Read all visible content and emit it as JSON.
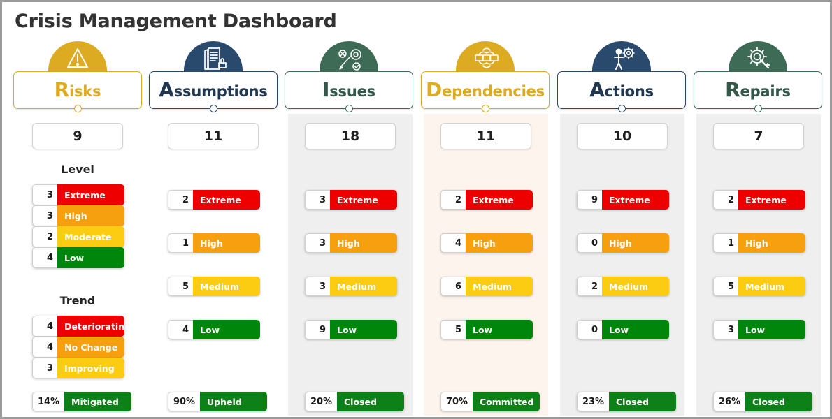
{
  "page": {
    "title": "Crisis Management Dashboard",
    "frame_border_color": "#9a9a9a",
    "background": "#ffffff"
  },
  "palette": {
    "extreme": "#ee0000",
    "high": "#f6a010",
    "moderate": "#fbcc12",
    "medium": "#fbcc12",
    "low": "#00860b",
    "deteriorating": "#ee0000",
    "no_change": "#f6a010",
    "improving": "#fbcc12",
    "footer_green": "#0e8018",
    "gold": "#ddab22",
    "navy": "#2a4a6d",
    "green": "#3d6b56",
    "panel_gray": "#efefef",
    "panel_cream": "#fdf5ed"
  },
  "columns": [
    {
      "key": "risks",
      "tab_label_cap": "R",
      "tab_label_rest": "isks",
      "icon": "warning-triangle-icon",
      "theme": "gold",
      "tab_border": "#ddab22",
      "tab_text_color": "#ddab22",
      "panel_bg": "none",
      "total": "9",
      "sections": [
        {
          "heading": "Level",
          "contiguous": true,
          "rows": [
            {
              "count": "3",
              "label": "Extreme",
              "color": "extreme"
            },
            {
              "count": "3",
              "label": "High",
              "color": "high"
            },
            {
              "count": "2",
              "label": "Moderate",
              "color": "moderate"
            },
            {
              "count": "4",
              "label": "Low",
              "color": "low"
            }
          ]
        },
        {
          "heading": "Trend",
          "contiguous": true,
          "rows": [
            {
              "count": "4",
              "label": "Deteriorating",
              "color": "deteriorating"
            },
            {
              "count": "4",
              "label": "No Change",
              "color": "no_change"
            },
            {
              "count": "3",
              "label": "Improving",
              "color": "improving"
            }
          ]
        }
      ],
      "footer": {
        "count": "14%",
        "label": "Mitigated",
        "color": "footer_green"
      }
    },
    {
      "key": "assumptions",
      "tab_label_cap": "A",
      "tab_label_rest": "ssumptions",
      "icon": "document-stamp-icon",
      "theme": "navy",
      "tab_border": "#2a4a6d",
      "tab_text_color": "#21364f",
      "panel_bg": "none",
      "total": "11",
      "sections": [
        {
          "heading": "",
          "contiguous": false,
          "rows": [
            {
              "count": "2",
              "label": "Extreme",
              "color": "extreme"
            },
            {
              "count": "1",
              "label": "High",
              "color": "high"
            },
            {
              "count": "5",
              "label": "Medium",
              "color": "medium"
            },
            {
              "count": "4",
              "label": "Low",
              "color": "low"
            }
          ]
        }
      ],
      "footer": {
        "count": "90%",
        "label": "Upheld",
        "color": "footer_green"
      }
    },
    {
      "key": "issues",
      "tab_label_cap": "I",
      "tab_label_rest": "ssues",
      "icon": "tools-gear-icon",
      "theme": "green",
      "tab_border": "#3d6b56",
      "tab_text_color": "#33584a",
      "panel_bg": "panel_gray",
      "total": "18",
      "sections": [
        {
          "heading": "",
          "contiguous": false,
          "rows": [
            {
              "count": "3",
              "label": "Extreme",
              "color": "extreme"
            },
            {
              "count": "3",
              "label": "High",
              "color": "high"
            },
            {
              "count": "3",
              "label": "Medium",
              "color": "medium"
            },
            {
              "count": "9",
              "label": "Low",
              "color": "low"
            }
          ]
        }
      ],
      "footer": {
        "count": "20%",
        "label": "Closed",
        "color": "footer_green"
      }
    },
    {
      "key": "dependencies",
      "tab_label_cap": "D",
      "tab_label_rest": "ependencies",
      "icon": "network-nodes-icon",
      "theme": "gold",
      "tab_border": "#ddab22",
      "tab_text_color": "#ddab22",
      "panel_bg": "panel_cream",
      "total": "11",
      "sections": [
        {
          "heading": "",
          "contiguous": false,
          "rows": [
            {
              "count": "2",
              "label": "Extreme",
              "color": "extreme"
            },
            {
              "count": "4",
              "label": "High",
              "color": "high"
            },
            {
              "count": "6",
              "label": "Medium",
              "color": "medium"
            },
            {
              "count": "5",
              "label": "Low",
              "color": "low"
            }
          ]
        }
      ],
      "footer": {
        "count": "70%",
        "label": "Committed",
        "color": "footer_green"
      }
    },
    {
      "key": "actions",
      "tab_label_cap": "A",
      "tab_label_rest": "ctions",
      "icon": "person-gear-icon",
      "theme": "navy",
      "tab_border": "#2a4a6d",
      "tab_text_color": "#21364f",
      "panel_bg": "panel_gray",
      "total": "10",
      "sections": [
        {
          "heading": "",
          "contiguous": false,
          "rows": [
            {
              "count": "9",
              "label": "Extreme",
              "color": "extreme"
            },
            {
              "count": "0",
              "label": "High",
              "color": "high"
            },
            {
              "count": "2",
              "label": "Medium",
              "color": "medium"
            },
            {
              "count": "0",
              "label": "Low",
              "color": "low"
            }
          ]
        }
      ],
      "footer": {
        "count": "23%",
        "label": "Closed",
        "color": "footer_green"
      }
    },
    {
      "key": "repairs",
      "tab_label_cap": "R",
      "tab_label_rest": "epairs",
      "icon": "gear-wrench-icon",
      "theme": "green",
      "tab_border": "#3d6b56",
      "tab_text_color": "#33584a",
      "panel_bg": "panel_gray",
      "total": "7",
      "sections": [
        {
          "heading": "",
          "contiguous": false,
          "rows": [
            {
              "count": "2",
              "label": "Extreme",
              "color": "extreme"
            },
            {
              "count": "1",
              "label": "High",
              "color": "high"
            },
            {
              "count": "5",
              "label": "Medium",
              "color": "medium"
            },
            {
              "count": "3",
              "label": "Low",
              "color": "low"
            }
          ]
        }
      ],
      "footer": {
        "count": "26%",
        "label": "Closed",
        "color": "footer_green"
      }
    }
  ]
}
